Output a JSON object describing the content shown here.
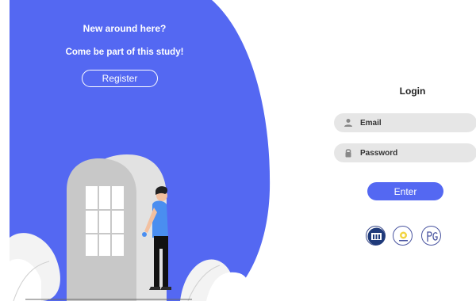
{
  "promo": {
    "heading": "New around here?",
    "subheading": "Come be part of this study!",
    "register_label": "Register"
  },
  "login": {
    "title": "Login",
    "email_placeholder": "Email",
    "password_placeholder": "Password",
    "enter_label": "Enter"
  },
  "logos": [
    "university-logo",
    "institute-logo",
    "pg-logo"
  ],
  "colors": {
    "accent": "#5468f2",
    "field_bg": "#e6e6e6",
    "door_gray": "#c8c8c8"
  }
}
